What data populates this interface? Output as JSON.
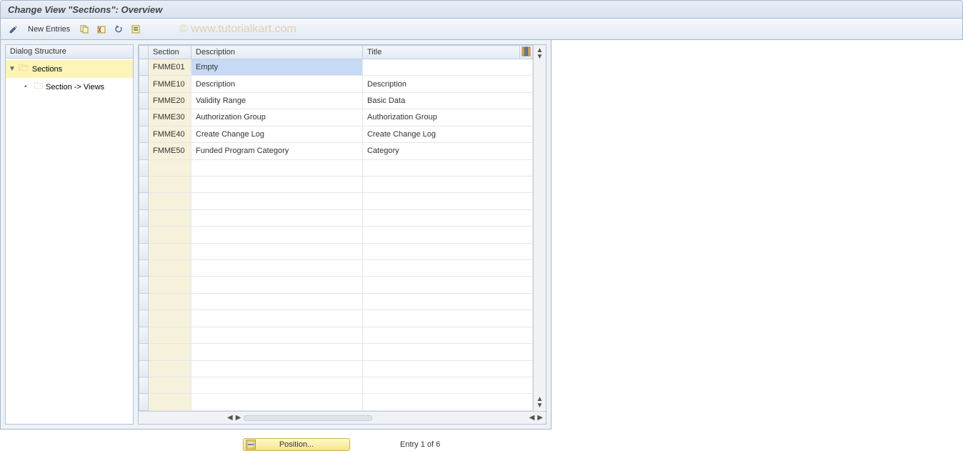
{
  "header": {
    "title": "Change View \"Sections\": Overview"
  },
  "toolbar": {
    "new_entries_label": "New Entries"
  },
  "watermark": "© www.tutorialkart.com",
  "tree": {
    "header": "Dialog Structure",
    "root": {
      "label": "Sections"
    },
    "child": {
      "label": "Section -> Views"
    }
  },
  "table": {
    "columns": {
      "section": "Section",
      "description": "Description",
      "title": "Title"
    },
    "rows": [
      {
        "section": "FMME01",
        "description": "Empty",
        "title": ""
      },
      {
        "section": "FMME10",
        "description": "Description",
        "title": "Description"
      },
      {
        "section": "FMME20",
        "description": "Validity Range",
        "title": "Basic Data"
      },
      {
        "section": "FMME30",
        "description": "Authorization Group",
        "title": "Authorization Group"
      },
      {
        "section": "FMME40",
        "description": "Create Change Log",
        "title": "Create Change Log"
      },
      {
        "section": "FMME50",
        "description": "Funded Program Category",
        "title": "Category"
      }
    ],
    "empty_row_count": 15
  },
  "footer": {
    "position_label": "Position...",
    "entry_text": "Entry 1 of 6"
  }
}
